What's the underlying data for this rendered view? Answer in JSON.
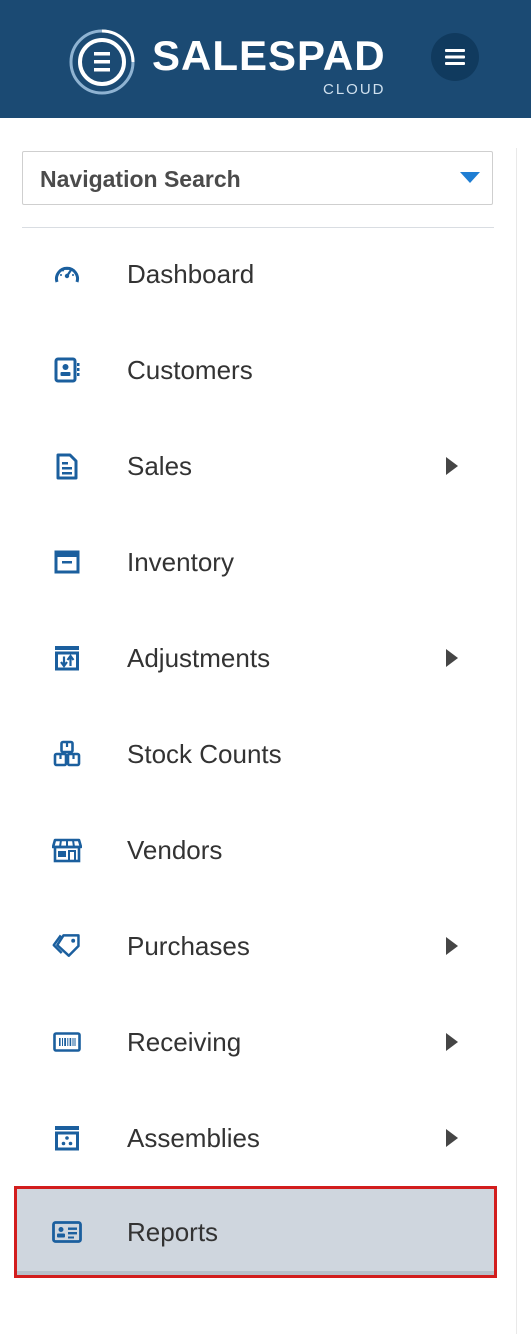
{
  "brand": {
    "name": "SALESPAD",
    "sub": "CLOUD",
    "tm": "™",
    "header_color": "#1b4a73",
    "accent_color": "#1f7ed3"
  },
  "header": {
    "menu_icon": "hamburger-icon"
  },
  "search": {
    "label": "Navigation Search",
    "caret_icon": "caret-down-icon"
  },
  "nav": {
    "items": [
      {
        "label": "Dashboard",
        "icon": "gauge-icon",
        "has_submenu": false
      },
      {
        "label": "Customers",
        "icon": "contact-card-icon",
        "has_submenu": false
      },
      {
        "label": "Sales",
        "icon": "document-icon",
        "has_submenu": true
      },
      {
        "label": "Inventory",
        "icon": "archive-box-icon",
        "has_submenu": false
      },
      {
        "label": "Adjustments",
        "icon": "adjust-arrows-icon",
        "has_submenu": true
      },
      {
        "label": "Stock Counts",
        "icon": "stacked-boxes-icon",
        "has_submenu": false
      },
      {
        "label": "Vendors",
        "icon": "storefront-icon",
        "has_submenu": false
      },
      {
        "label": "Purchases",
        "icon": "tag-icon",
        "has_submenu": true
      },
      {
        "label": "Receiving",
        "icon": "barcode-icon",
        "has_submenu": true
      },
      {
        "label": "Assemblies",
        "icon": "assembly-box-icon",
        "has_submenu": true
      },
      {
        "label": "Reports",
        "icon": "report-card-icon",
        "has_submenu": false,
        "selected": true
      }
    ]
  }
}
